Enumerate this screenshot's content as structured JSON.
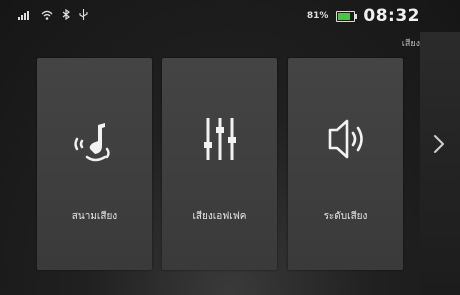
{
  "status": {
    "battery_percent": "81%",
    "battery_level": 0.81,
    "time": "08:32",
    "icons": [
      "signal-icon",
      "wifi-icon",
      "bluetooth-icon",
      "usb-icon"
    ]
  },
  "screen_title": "เสียง",
  "menu": {
    "items": [
      {
        "label": "สนามเสียง",
        "icon": "sound-field-icon"
      },
      {
        "label": "เสียงเอฟเฟค",
        "icon": "equalizer-icon"
      },
      {
        "label": "ระดับเสียง",
        "icon": "speaker-icon"
      }
    ]
  },
  "colors": {
    "battery": "#3fc84a",
    "card": "#444444",
    "background": "#1a1a1a"
  }
}
